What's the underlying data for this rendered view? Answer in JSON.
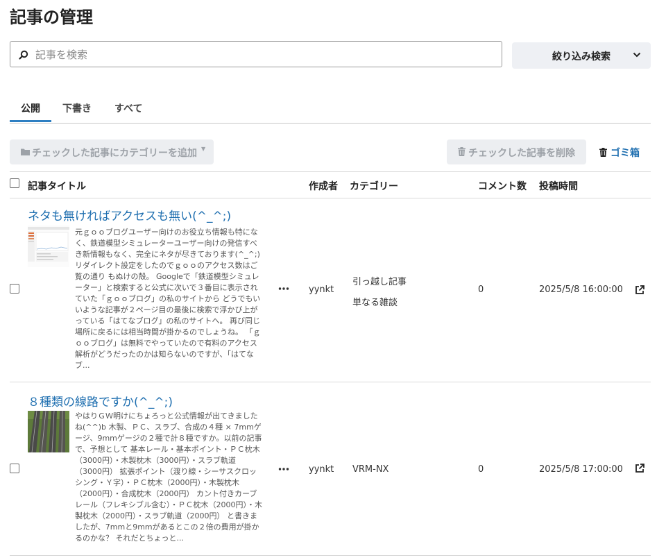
{
  "page": {
    "title": "記事の管理"
  },
  "search": {
    "placeholder": "記事を検索",
    "value": ""
  },
  "filter": {
    "label": "絞り込み検索"
  },
  "tabs": [
    {
      "label": "公開",
      "active": true
    },
    {
      "label": "下書き",
      "active": false
    },
    {
      "label": "すべて",
      "active": false
    }
  ],
  "actions": {
    "add_category": "チェックした記事にカテゴリーを追加",
    "delete_checked": "チェックした記事を削除",
    "trash": "ゴミ箱"
  },
  "table": {
    "columns": {
      "title": "記事タイトル",
      "author": "作成者",
      "category": "カテゴリー",
      "comments": "コメント数",
      "posted": "投稿時間"
    },
    "rows": [
      {
        "title": "ネタも無ければアクセスも無い(^_^;)",
        "excerpt": "元ｇｏｏブログユーザー向けのお役立ち情報も特になく、鉄道模型シミュレーターユーザー向けの発信すべき新情報もなく、完全にネタが尽きております(^_^;) リダイレクト設定をしたのでｇｏｏのアクセス数はご覧の通り もぬけの殻。 Googleで「鉄道模型シミュレーター」と検索すると公式に次いで３番目に表示されていた「ｇｏｏブログ」の私のサイトから どうでもいいような記事が２ページ目の最後に検索で浮かび上がっている「はてなブログ」の私のサイトへ。 再び同じ場所に戻るには相当時間が掛かるのでしょうね。 「ｇｏｏブログ」は無料でやっていたので有料のアクセス解析がどうだったのかは知らないのですが、「はてなブ...",
        "author": "yynkt",
        "categories": [
          "引っ越し記事",
          "単なる雑談"
        ],
        "comments": "0",
        "posted": "2025/5/8 16:00:00",
        "thumb": "analytics-screenshot"
      },
      {
        "title": "８種類の線路ですか(^_^;)",
        "excerpt": "やはりＧＷ明けにちょろっと公式情報が出てきましたね(^^)b 木製、ＰＣ、スラブ、合成の４種 × 7mmゲージ、9mmゲージの２種で計８種ですか。以前の記事で、予想として 基本レール・基本ポイント・ＰＣ枕木（3000円）・木製枕木（3000円）・スラブ軌道（3000円） 拡張ポイント（渡り線・シーサスクロッシング・Ｙ字）・ＰＣ枕木（2000円）・木製枕木（2000円）・合成枕木（2000円） カント付きカーブレール（フレキシブル含む）・ＰＣ枕木（2000円）・木製枕木（2000円）・スラブ軌道（2000円） と書きましたが、7mmと9mmがあるとこの２倍の費用が掛かるのかな？ それだとちょっと...",
        "author": "yynkt",
        "categories": [
          "VRM-NX"
        ],
        "comments": "0",
        "posted": "2025/5/8 17:00:00",
        "thumb": "railway-tracks"
      }
    ]
  },
  "colors": {
    "link": "#1f6fb0",
    "tab_underline": "#2e7fc2",
    "disabled_bg": "#eceef1",
    "disabled_text": "#9da2a8"
  },
  "icons": [
    "search-icon",
    "chevron-down-icon",
    "folder-icon",
    "trash-icon",
    "more-icon",
    "external-link-icon"
  ]
}
